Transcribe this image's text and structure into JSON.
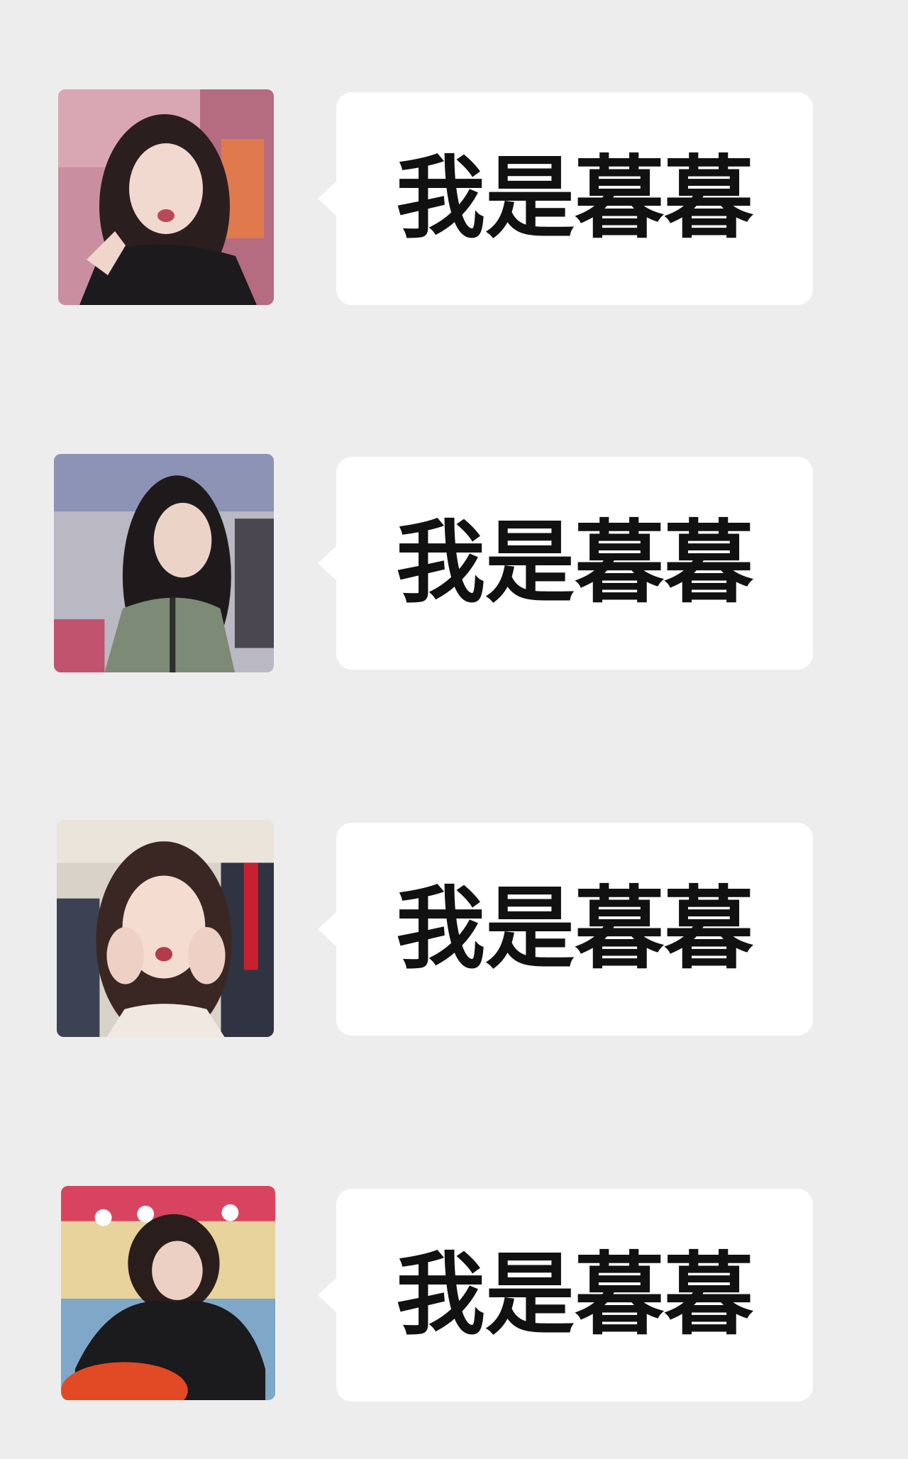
{
  "chat": {
    "messages": [
      {
        "sender": "avatar-1",
        "text": "我是暮暮"
      },
      {
        "sender": "avatar-2",
        "text": "我是暮暮"
      },
      {
        "sender": "avatar-3",
        "text": "我是暮暮"
      },
      {
        "sender": "avatar-4",
        "text": "我是暮暮"
      }
    ]
  },
  "colors": {
    "background": "#ededed",
    "bubble": "#ffffff",
    "text": "#111111"
  }
}
